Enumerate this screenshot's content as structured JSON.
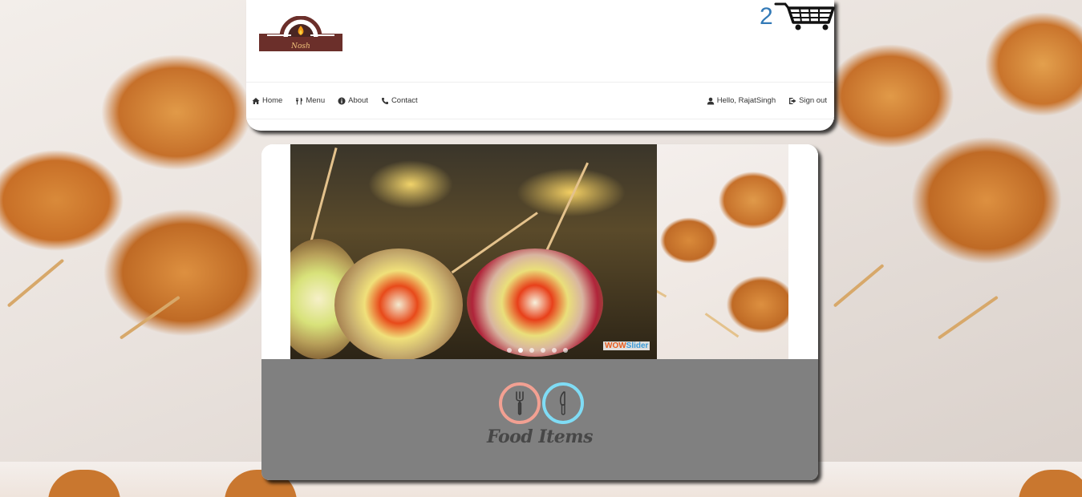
{
  "header": {
    "logo_text": "Nosh",
    "cart": {
      "count": "2",
      "icon": "shopping-cart-icon"
    }
  },
  "nav": {
    "left": [
      {
        "label": "Home",
        "icon": "home-icon"
      },
      {
        "label": "Menu",
        "icon": "cutlery-icon"
      },
      {
        "label": "About",
        "icon": "info-icon"
      },
      {
        "label": "Contact",
        "icon": "phone-icon"
      }
    ],
    "right": [
      {
        "label": "Hello, RajatSingh",
        "icon": "user-icon"
      },
      {
        "label": "Sign out",
        "icon": "sign-out-icon"
      }
    ]
  },
  "slider": {
    "watermark_a": "WOW",
    "watermark_b": "Slider",
    "dot_count": 6,
    "active_dot": 1
  },
  "food_section": {
    "title": "Food Items",
    "icons": [
      "fork-icon",
      "knife-icon"
    ],
    "colors": {
      "fork_ring": "#f2a092",
      "knife_ring": "#7fdcf5"
    }
  },
  "colors": {
    "cart_count": "#337ab7",
    "food_panel_bg": "#808080",
    "nav_text": "#333333"
  }
}
